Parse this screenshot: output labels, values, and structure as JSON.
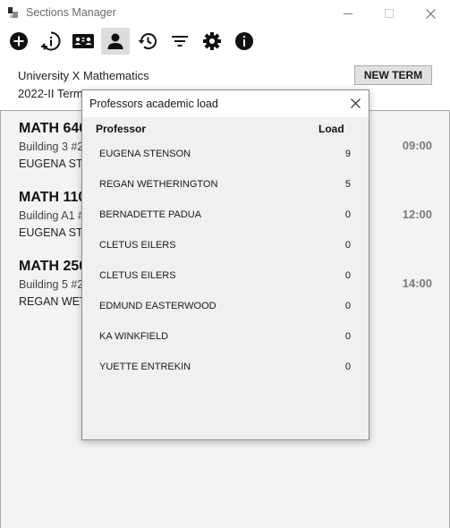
{
  "window": {
    "title": "Sections Manager"
  },
  "toolbar": {
    "buttons": [
      {
        "icon": "add-circle-icon"
      },
      {
        "icon": "info-plus-icon"
      },
      {
        "icon": "id-card-icon"
      },
      {
        "icon": "person-icon",
        "active": true
      },
      {
        "icon": "history-icon"
      },
      {
        "icon": "filter-icon"
      },
      {
        "icon": "gear-icon"
      },
      {
        "icon": "info-icon"
      }
    ]
  },
  "header": {
    "university": "University X Mathematics",
    "term": "2022-II Term",
    "new_term_label": "NEW TERM"
  },
  "sections": [
    {
      "code": "MATH 640",
      "room": "Building 3 #2",
      "professor": "EUGENA STE",
      "time": "09:00"
    },
    {
      "code": "MATH 110",
      "room": "Building A1 #",
      "professor": "EUGENA STE",
      "time": "12:00"
    },
    {
      "code": "MATH 250",
      "room": "Building 5 #2",
      "professor": "REGAN WET",
      "time": "14:00"
    }
  ],
  "dialog": {
    "title": "Professors academic load",
    "columns": {
      "professor": "Professor",
      "load": "Load"
    },
    "rows": [
      {
        "name": "EUGENA STENSON",
        "load": "9"
      },
      {
        "name": "REGAN WETHERINGTON",
        "load": "5"
      },
      {
        "name": "BERNADETTE PADUA",
        "load": "0"
      },
      {
        "name": "CLETUS EILERS",
        "load": "0"
      },
      {
        "name": "CLETUS EILERS",
        "load": "0"
      },
      {
        "name": "EDMUND EASTERWOOD",
        "load": "0"
      },
      {
        "name": "KA WINKFIELD",
        "load": "0"
      },
      {
        "name": "YUETTE ENTREKIN",
        "load": "0"
      }
    ]
  },
  "colors": {
    "list_background": "#f3f3f3",
    "dialog_background": "#f0f0f0",
    "active_tool": "#dcdcdc",
    "time_text": "#7a7a7a"
  }
}
